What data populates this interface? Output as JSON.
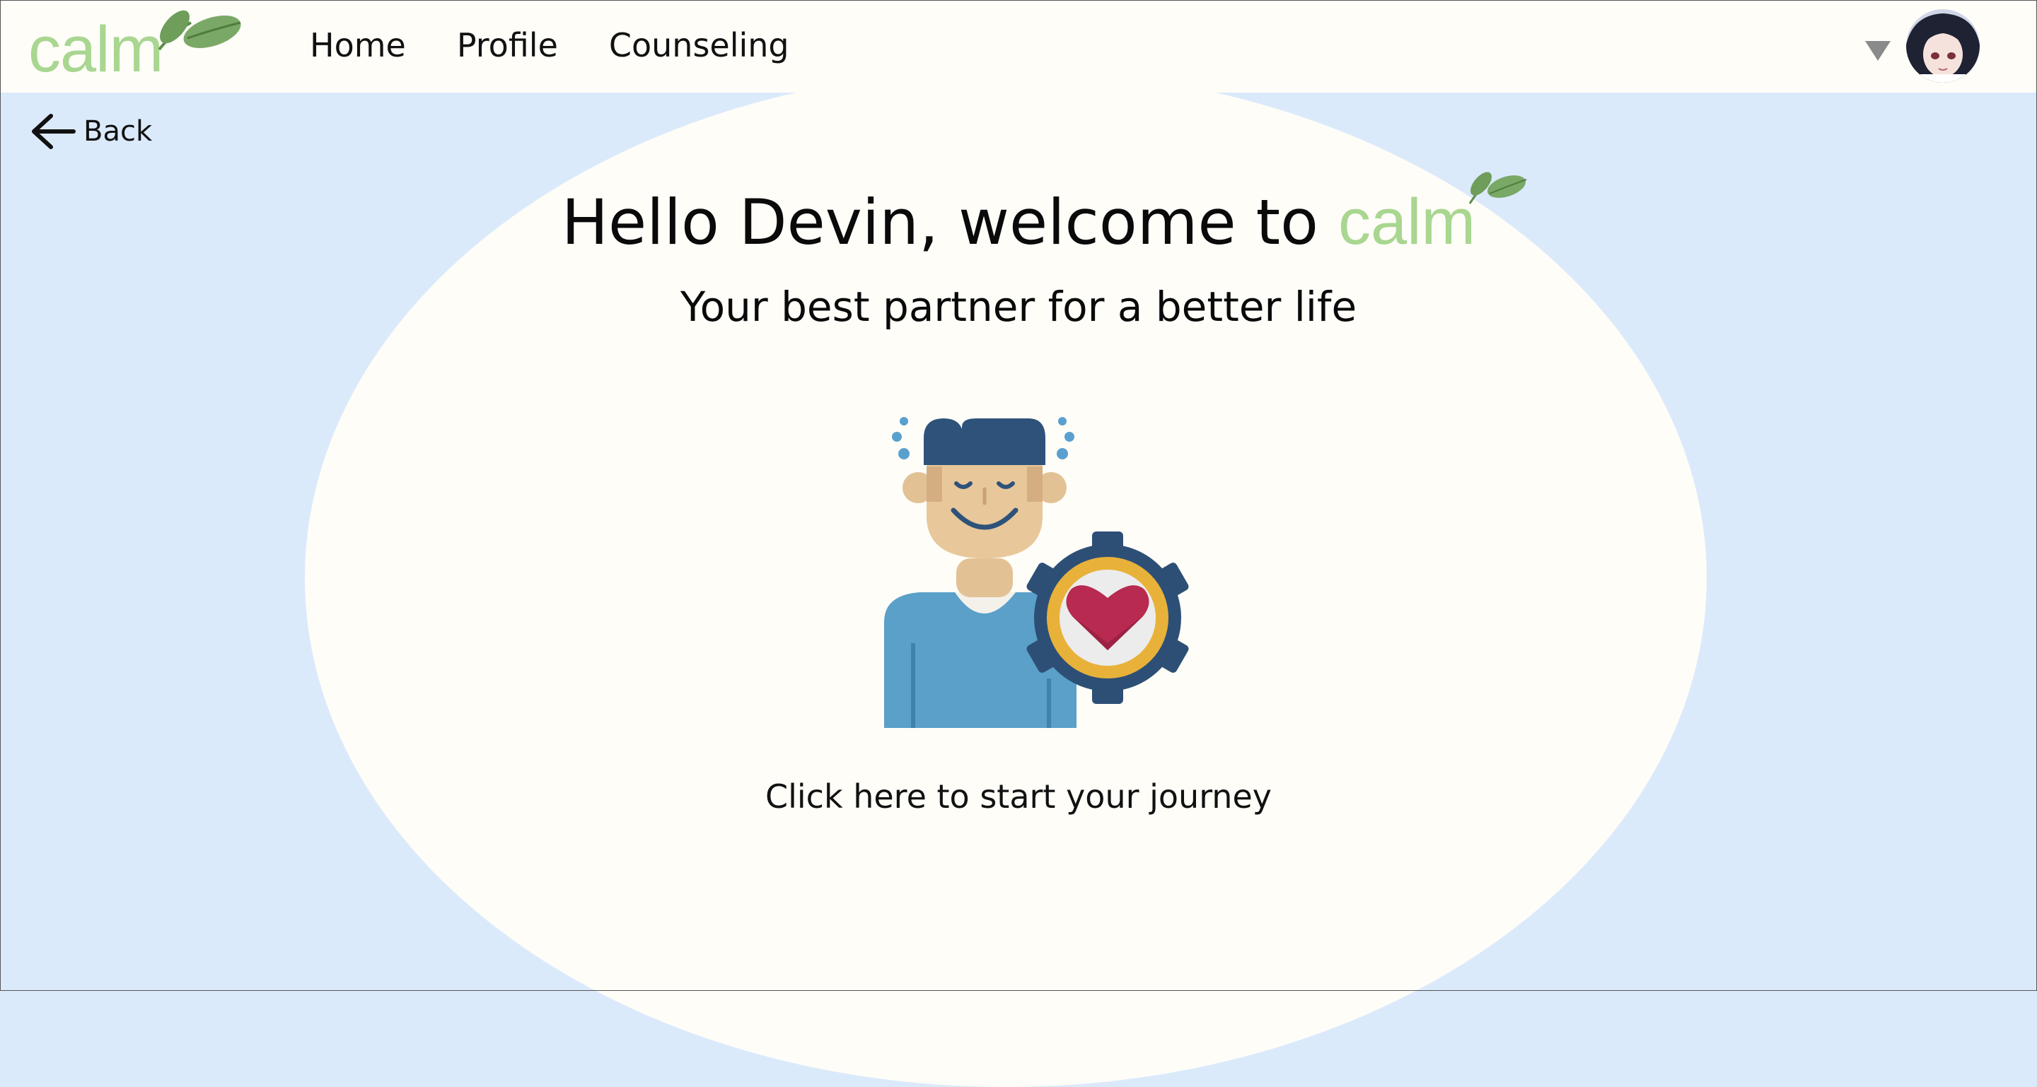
{
  "brand": {
    "name": "calm",
    "color": "#a9d690",
    "leaf_color": "#6e9e5a"
  },
  "nav": {
    "items": [
      {
        "label": "Home"
      },
      {
        "label": "Profile"
      },
      {
        "label": "Counseling"
      }
    ]
  },
  "account": {
    "caret_icon": "caret-down-icon",
    "avatar_icon": "user-avatar"
  },
  "back": {
    "label": "Back",
    "icon": "arrow-left-icon"
  },
  "hero": {
    "greeting": "Hello Devin, welcome to",
    "brand_word": "calm",
    "tagline": "Your best partner for a better life",
    "illustration_icon": "person-with-heart-gear-icon",
    "cta_label": "Click here to start your journey"
  },
  "colors": {
    "page_background": "#dbeafb",
    "panel_background": "#fefdf8",
    "text": "#111111"
  }
}
